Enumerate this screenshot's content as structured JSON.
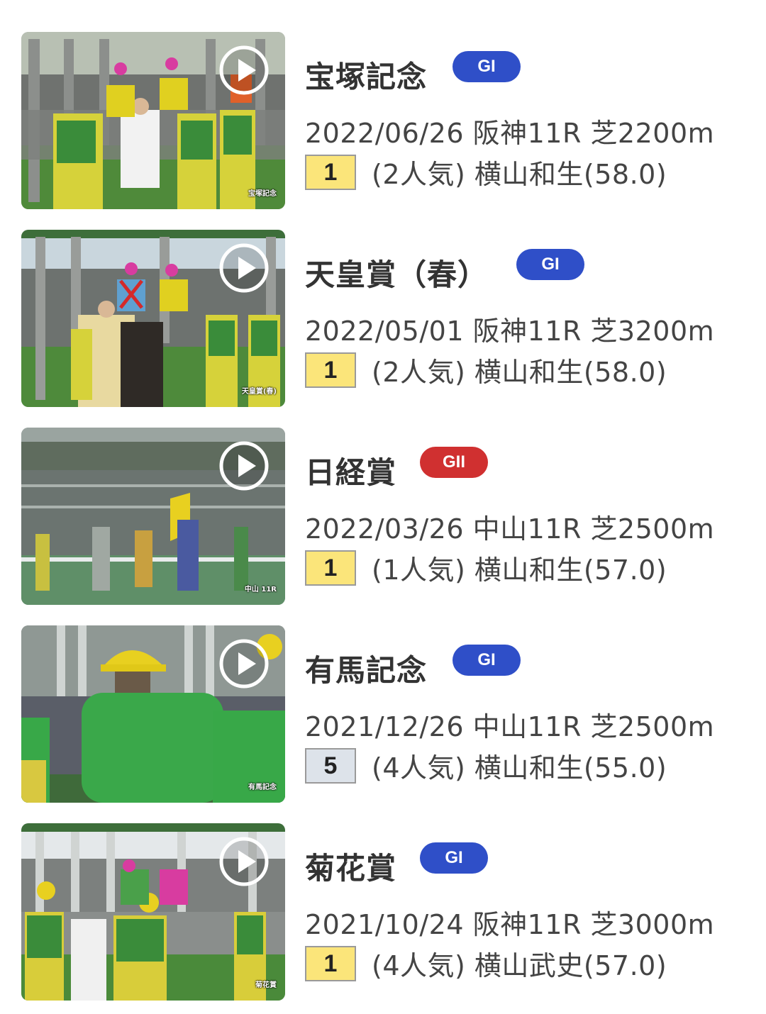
{
  "colors": {
    "grade_g1": "#2f4fc8",
    "grade_g2": "#d03030",
    "place_win": "#fbe57a",
    "place_other": "#dde3ea"
  },
  "races": [
    {
      "title": "宝塚記念",
      "grade": "GI",
      "info": "2022/06/26 阪神11R 芝2200m",
      "place": "1",
      "result": "(2人気) 横山和生(58.0)",
      "caption": "宝塚記念",
      "play_icon": "play-icon"
    },
    {
      "title": "天皇賞（春）",
      "grade": "GI",
      "info": "2022/05/01 阪神11R 芝3200m",
      "place": "1",
      "result": "(2人気) 横山和生(58.0)",
      "caption": "天皇賞(春)",
      "play_icon": "play-icon"
    },
    {
      "title": "日経賞",
      "grade": "GII",
      "info": "2022/03/26 中山11R 芝2500m",
      "place": "1",
      "result": "(1人気) 横山和生(57.0)",
      "caption": "中山 11R",
      "play_icon": "play-icon"
    },
    {
      "title": "有馬記念",
      "grade": "GI",
      "info": "2021/12/26 中山11R 芝2500m",
      "place": "5",
      "result": "(4人気) 横山和生(55.0)",
      "caption": "有馬記念",
      "play_icon": "play-icon"
    },
    {
      "title": "菊花賞",
      "grade": "GI",
      "info": "2021/10/24 阪神11R 芝3000m",
      "place": "1",
      "result": "(4人気) 横山武史(57.0)",
      "caption": "菊花賞",
      "play_icon": "play-icon"
    }
  ]
}
